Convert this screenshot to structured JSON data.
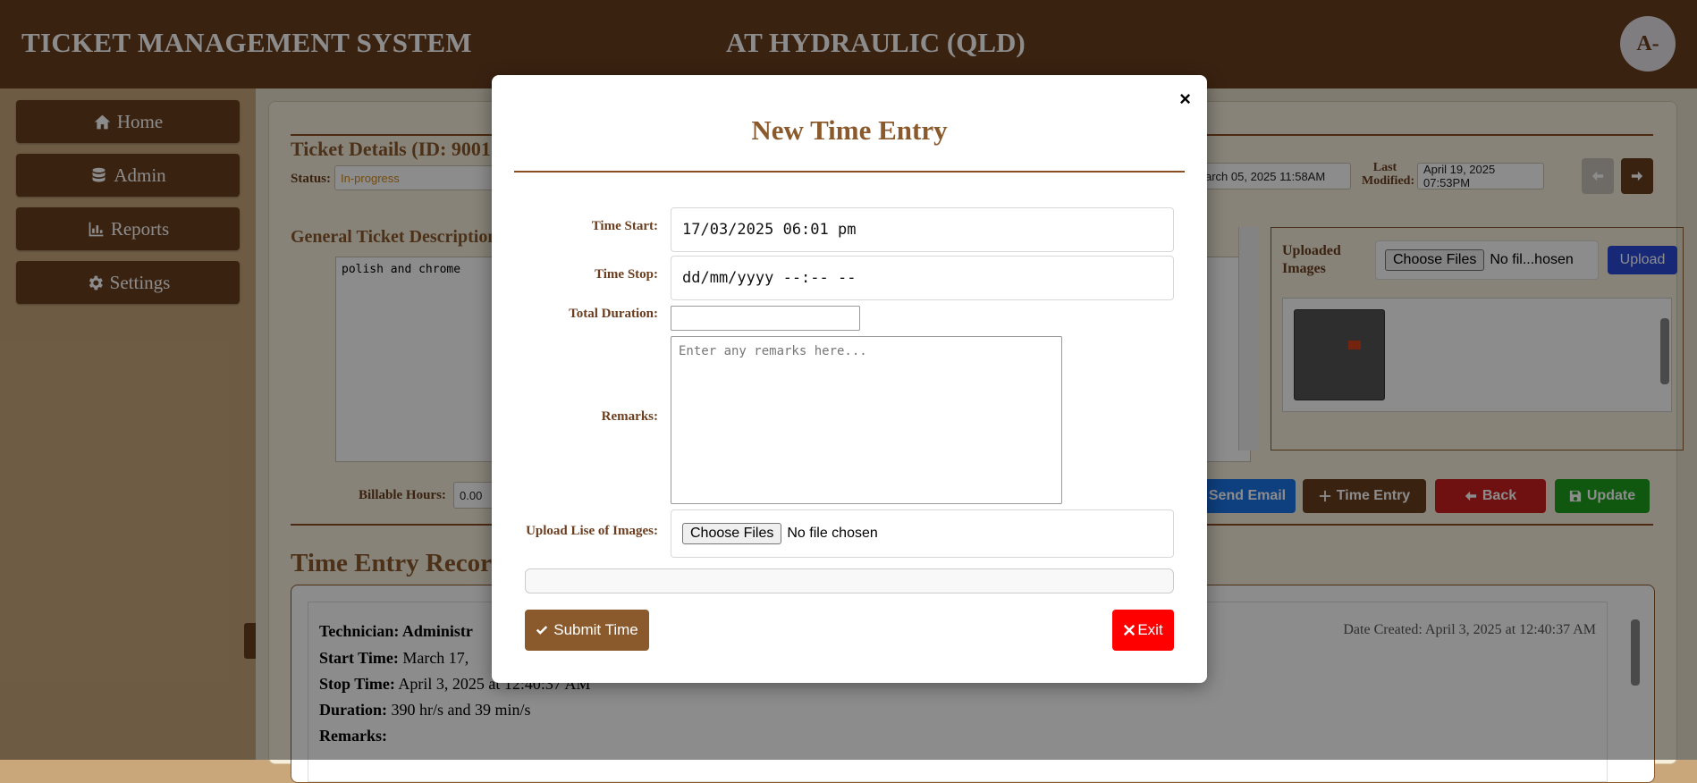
{
  "header": {
    "app_title": "TICKET MANAGEMENT SYSTEM",
    "company": "AT HYDRAULIC (QLD)",
    "avatar": "A-"
  },
  "sidebar": {
    "items": [
      {
        "label": "Home",
        "icon": "home-icon"
      },
      {
        "label": "Admin",
        "icon": "database-icon"
      },
      {
        "label": "Reports",
        "icon": "chart-icon"
      },
      {
        "label": "Settings",
        "icon": "gear-icon"
      }
    ]
  },
  "ticket": {
    "heading": "Ticket Details (ID: 9001",
    "status_label": "Status:",
    "status_value": "In-progress",
    "created_value": "arch 05, 2025 11:58AM",
    "last_modified_label_1": "Last",
    "last_modified_label_2": "Modified:",
    "last_modified_value": "April 19, 2025 07:53PM",
    "description_heading": "General Ticket Description",
    "description_text": "polish and chrome",
    "uploaded_images_label_1": "Uploaded",
    "uploaded_images_label_2": "Images",
    "choose_files": "Choose Files",
    "no_file_short": "No fil...hosen",
    "upload_button": "Upload",
    "billable_label": "Billable Hours:",
    "billable_value": "0.00",
    "send_email": "Send Email",
    "time_entry": "Time Entry",
    "back": "Back",
    "update": "Update"
  },
  "records": {
    "heading": "Time Entry Recor",
    "technician_label": "Technician: Administr",
    "date_created": "Date Created: April 3, 2025 at 12:40:37 AM",
    "start_label": "Start Time:",
    "start_value": "March 17,",
    "stop_label": "Stop Time:",
    "stop_value": "April 3, 2025 at 12:40:37 AM",
    "duration_label": "Duration:",
    "duration_value": "390 hr/s and 39 min/s",
    "remarks_label": "Remarks:"
  },
  "modal": {
    "close": "×",
    "title": "New Time Entry",
    "time_start_label": "Time Start:",
    "time_start_value": "17/03/2025 06:01 pm",
    "time_stop_label": "Time Stop:",
    "time_stop_value": "dd/mm/yyyy --:-- --",
    "total_duration_label": "Total Duration:",
    "total_duration_value": "",
    "remarks_label": "Remarks:",
    "remarks_placeholder": "Enter any remarks here...",
    "upload_label": "Upload Lise of Images:",
    "choose_files": "Choose Files",
    "no_file": "No file chosen",
    "submit": "Submit Time",
    "exit": "Exit"
  },
  "colors": {
    "brand_brown": "#6b3e1f",
    "accent_brown": "#8a5a2c",
    "exit_red": "#ff0000",
    "back_red": "#cc1f1f",
    "update_green": "#1e9e1e",
    "send_blue": "#1a73e8",
    "upload_blue": "#2a4bd7"
  }
}
